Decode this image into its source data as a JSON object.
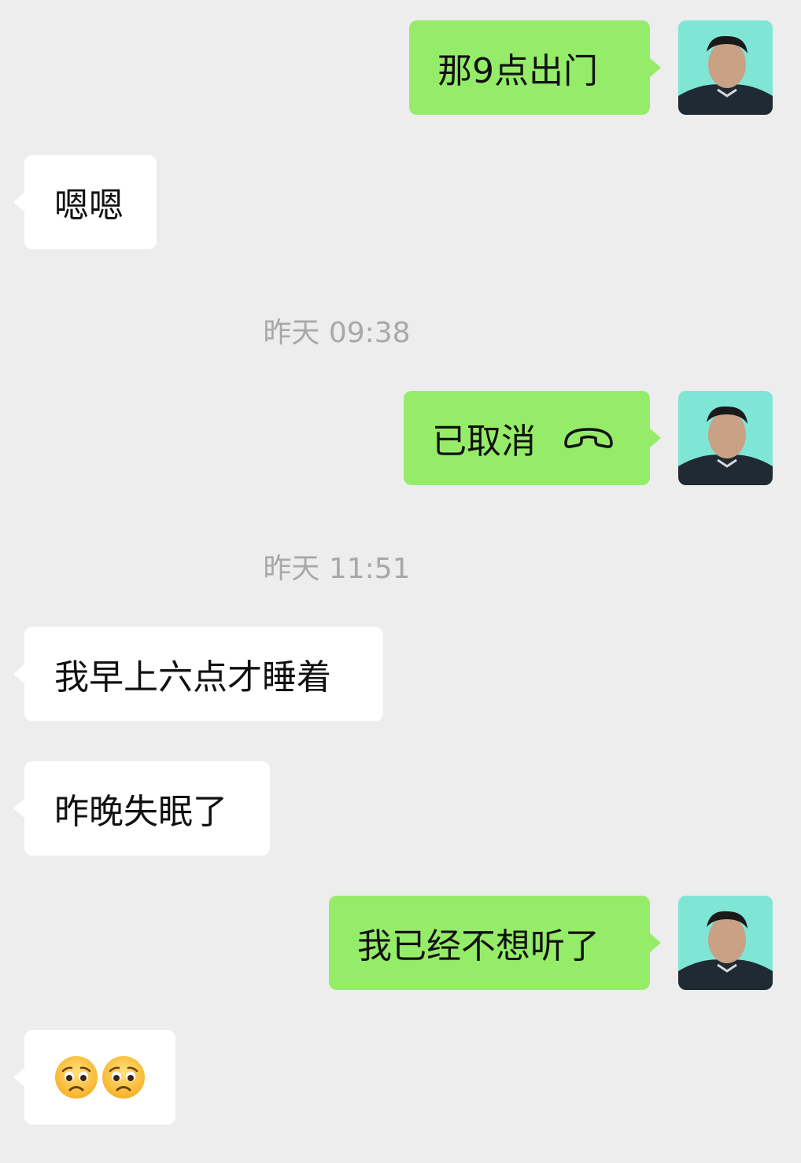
{
  "messages": [
    {
      "side": "sent",
      "text": "那9点出门",
      "avatar": "user-avatar"
    },
    {
      "side": "recv",
      "text": "嗯嗯"
    },
    {
      "timestamp": "昨天 09:38"
    },
    {
      "side": "sent",
      "text": "已取消",
      "icon": "hang-up-phone-icon",
      "avatar": "user-avatar"
    },
    {
      "timestamp": "昨天 11:51"
    },
    {
      "side": "recv",
      "text": "我早上六点才睡着"
    },
    {
      "side": "recv",
      "text": "昨晚失眠了"
    },
    {
      "side": "sent",
      "text": "我已经不想听了",
      "avatar": "user-avatar"
    },
    {
      "side": "recv",
      "emojis": [
        "pleading-sad-face-emoji",
        "pleading-sad-face-emoji"
      ]
    }
  ],
  "colors": {
    "background": "#EDEDED",
    "sent_bubble": "#95EC69",
    "received_bubble": "#FFFFFF",
    "timestamp_text": "#A8A8A8"
  }
}
